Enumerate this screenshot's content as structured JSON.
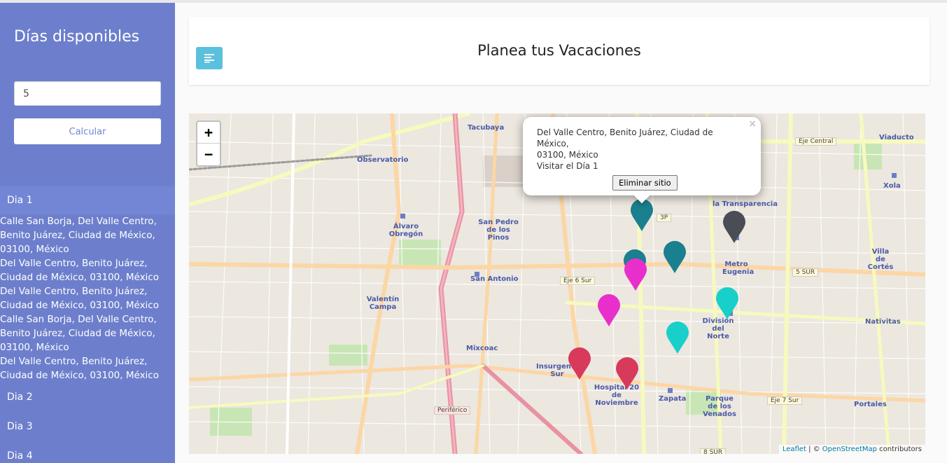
{
  "sidebar": {
    "title": "Días disponibles",
    "days_input_value": "5",
    "calculate_label": "Calcular",
    "days": [
      {
        "label": "Dia 1",
        "places": [
          "Calle San Borja, Del Valle Centro, Benito Juárez, Ciudad de México, 03100, México",
          "Del Valle Centro, Benito Juárez, Ciudad de México, 03100, México",
          "Del Valle Centro, Benito Juárez, Ciudad de México, 03100, México",
          "Calle San Borja, Del Valle Centro, Benito Juárez, Ciudad de México, 03100, México",
          "Del Valle Centro, Benito Juárez, Ciudad de México, 03100, México"
        ]
      },
      {
        "label": "Dia 2"
      },
      {
        "label": "Dia 3"
      },
      {
        "label": "Dia 4"
      }
    ]
  },
  "navbar": {
    "title": "Planea tus Vacaciones",
    "toggle_icon": "align-left-icon"
  },
  "map": {
    "zoom_in": "+",
    "zoom_out": "−",
    "popup": {
      "line1": "Del Valle Centro, Benito Juárez, Ciudad de México,",
      "line2": "03100, México",
      "line3": "Visitar el Día 1",
      "close": "×",
      "remove_label": "Eliminar sitio"
    },
    "attribution": {
      "leaflet": "Leaflet",
      "sep": " | © ",
      "osm": "OpenStreetMap",
      "contributors": " contributors"
    },
    "place_labels": {
      "tacubaya": "Tacubaya",
      "observatorio": "Observatorio",
      "alvaro_obregon": "Álvaro Obregón",
      "san_pedro": "San Pedro de los Pinos",
      "san_antonio": "San Antonio",
      "valentin_campa": "Valentín Campa",
      "mixcoac": "Mixcoac",
      "insurgentes_sur": "Insurgentes Sur",
      "hospital": "Hospital 20 de Noviembre",
      "zapata": "Zapata",
      "parque_venados": "Parque de los Venados",
      "division_norte": "División del Norte",
      "metro_eugenia": "Metro Eugenia",
      "villa_cortes": "Villa de Cortés",
      "nativitas": "Nativitas",
      "portales": "Portales",
      "viaducto": "Viaducto",
      "xola": "Xola",
      "transparencia": "la Transparencia"
    },
    "road_labels": {
      "eje6": "Eje 6 Sur",
      "eje7": "Eje 7 Sur",
      "eje_central": "Eje Central",
      "sur5": "5 SUR",
      "periferico": "Periférico",
      "sur8": "8 SUR",
      "p3": "3P"
    },
    "markers": [
      {
        "color": "#1a7f8e"
      },
      {
        "color": "#1a7f8e"
      },
      {
        "color": "#1a7f8e"
      },
      {
        "color": "#4a4d55"
      },
      {
        "color": "#e92fcb"
      },
      {
        "color": "#e92fcb"
      },
      {
        "color": "#18d0c9"
      },
      {
        "color": "#18d0c9"
      },
      {
        "color": "#d73a5a"
      },
      {
        "color": "#d73a5a"
      }
    ]
  }
}
